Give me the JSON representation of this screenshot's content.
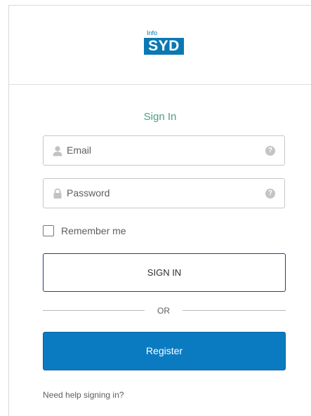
{
  "logo": {
    "small_text": "Info",
    "main_text": "SYD"
  },
  "form": {
    "title": "Sign In",
    "email_placeholder": "Email",
    "password_placeholder": "Password",
    "remember_label": "Remember me",
    "remember_checked": false,
    "signin_label": "SIGN IN",
    "or_text": "OR",
    "register_label": "Register",
    "help_link": "Need help signing in?"
  },
  "colors": {
    "title": "#4ba07e",
    "brand_blue": "#0b78b3",
    "register_bg": "#0b7bc1",
    "signin_border": "#1f3d86"
  },
  "icons": {
    "email_field": "person-icon",
    "password_field": "lock-icon",
    "field_help": "question-circle-icon"
  }
}
